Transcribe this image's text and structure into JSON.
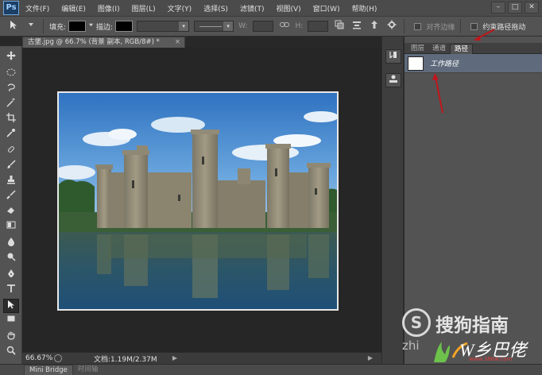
{
  "app": {
    "logo": "Ps"
  },
  "menubar": {
    "items": [
      "文件(F)",
      "编辑(E)",
      "图像(I)",
      "图层(L)",
      "文字(Y)",
      "选择(S)",
      "滤镜(T)",
      "视图(V)",
      "窗口(W)",
      "帮助(H)"
    ],
    "controls": [
      "–",
      "□",
      "✕"
    ]
  },
  "options": {
    "fill_label": "填充:",
    "stroke_label": "描边:",
    "w_label": "W:",
    "h_label": "H:",
    "align_edges_label": "对齐边缘",
    "constrain_path_label": "约束路径拖动"
  },
  "tools": {
    "icons": [
      "move-icon",
      "marquee-icon",
      "lasso-icon",
      "magic-wand-icon",
      "crop-icon",
      "eyedropper-icon",
      "healing-brush-icon",
      "brush-icon",
      "clone-stamp-icon",
      "history-brush-icon",
      "eraser-icon",
      "gradient-icon",
      "blur-icon",
      "dodge-icon",
      "pen-icon",
      "type-icon",
      "path-selection-icon",
      "rectangle-icon",
      "hand-icon",
      "zoom-icon"
    ]
  },
  "document": {
    "tab_title": "古堡.jpg @ 66.7% (背景 副本, RGB/8#) *",
    "close_label": "×"
  },
  "status": {
    "zoom": "66.67%",
    "doc_info": "文档:1.19M/2.37M"
  },
  "bottom_tabs": {
    "mini_bridge": "Mini Bridge",
    "timeline": "时间轴"
  },
  "panel": {
    "tabs": [
      "图层",
      "通道",
      "路径"
    ],
    "active_tab": "路径",
    "paths": [
      {
        "name": "工作路径"
      }
    ]
  },
  "watermark": {
    "logo_glyph": "S",
    "brand": "搜狗指南",
    "zhi": "zhi",
    "site": "www.386w.com",
    "site_logo_text": "W乡巴佬"
  },
  "colors": {
    "annotation_arrow": "#c0161c",
    "panel_selected_row": "#5f6b7c"
  }
}
